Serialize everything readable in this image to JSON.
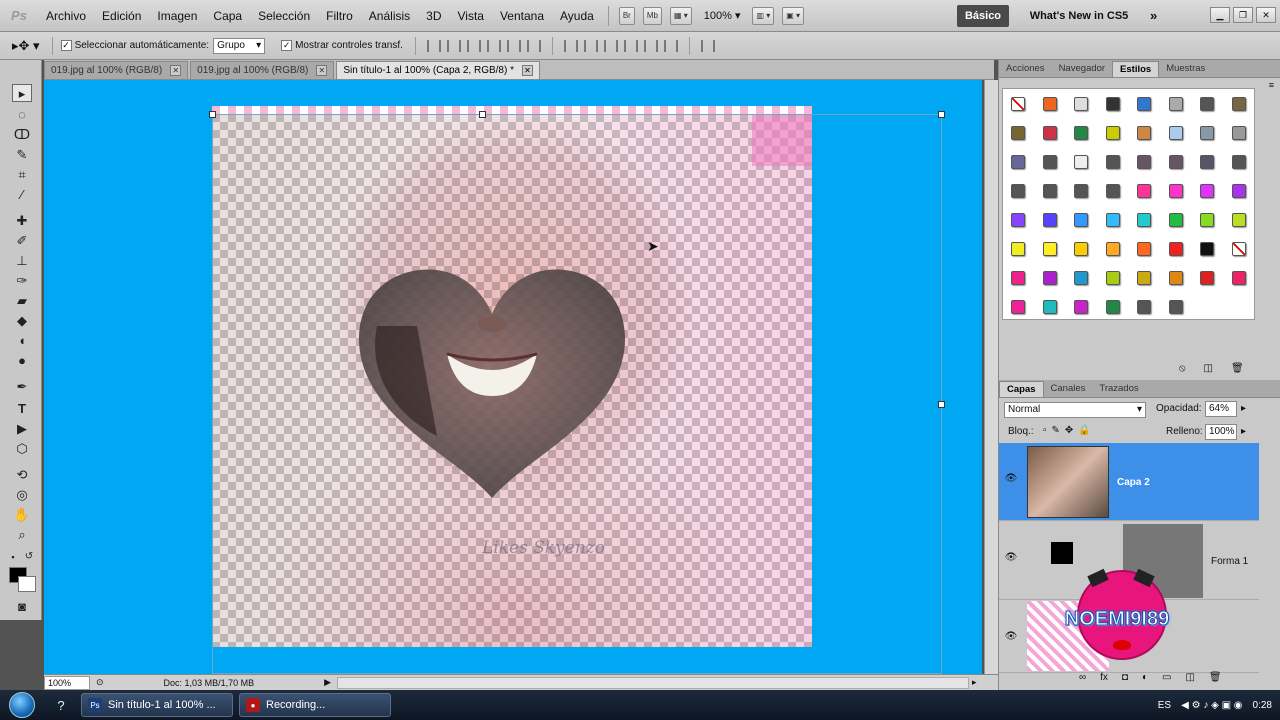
{
  "menubar": {
    "logo": "Ps",
    "items": [
      "Archivo",
      "Edición",
      "Imagen",
      "Capa",
      "Selección",
      "Filtro",
      "Análisis",
      "3D",
      "Vista",
      "Ventana",
      "Ayuda"
    ],
    "br_label": "Br",
    "mb_label": "Mb",
    "zoom": "100%",
    "workspace_active": "Básico",
    "workspace_new": "What's New in CS5"
  },
  "options": {
    "auto_select_label": "Seleccionar automáticamente:",
    "auto_select_value": "Grupo",
    "show_transform_label": "Mostrar controles transf."
  },
  "tabs": [
    {
      "label": "019.jpg al 100% (RGB/8)"
    },
    {
      "label": "019.jpg al 100% (RGB/8)"
    },
    {
      "label": "Sin título-1 al 100% (Capa 2, RGB/8) *"
    }
  ],
  "canvas": {
    "watermark": "Likes Skyenzo"
  },
  "status": {
    "zoom": "100%",
    "doc": "Doc: 1,03 MB/1,70 MB"
  },
  "panels": {
    "top_tabs": [
      "Acciones",
      "Navegador",
      "Estilos",
      "Muestras"
    ],
    "active_top_tab": "Estilos",
    "layer_tabs": [
      "Capas",
      "Canales",
      "Trazados"
    ],
    "blend_mode": "Normal",
    "opacity_label": "Opacidad:",
    "opacity_value": "64%",
    "lock_label": "Bloq.:",
    "fill_label": "Relleno:",
    "fill_value": "100%",
    "layers": [
      {
        "name": "Capa 2"
      },
      {
        "name": "Forma 1"
      }
    ],
    "logo_text": "NOEMI9I89"
  },
  "styles_swatches": [
    "#ffffff",
    "#ee6622",
    "#dddddd",
    "#333333",
    "#3377cc",
    "#aaaaaa",
    "#555555",
    "#776644",
    "#776633",
    "#cc3344",
    "#228844",
    "#cccc00",
    "#cc8844",
    "#aaccee",
    "#8899aa",
    "#999999",
    "#666699",
    "#555555",
    "#eeeeee",
    "#555555",
    "#665566",
    "#665566",
    "#555566",
    "#555555",
    "#555555",
    "#555555",
    "#555555",
    "#555555",
    "#ff3399",
    "#ff33cc",
    "#dd33ff",
    "#aa33ee",
    "#8844ff",
    "#5544ff",
    "#3399ff",
    "#33bbff",
    "#22cccc",
    "#22bb44",
    "#88dd22",
    "#bbdd22",
    "#eeee22",
    "#ffee22",
    "#ffcc00",
    "#ffaa22",
    "#ff6622",
    "#ee2222",
    "#111111",
    "#ffffff",
    "#ee2288",
    "#aa22cc",
    "#2299cc",
    "#aacc11",
    "#ccaa11",
    "#dd8811",
    "#dd2222",
    "#ee2266",
    "#ee2299",
    "#22bbbb",
    "#cc22cc",
    "#228844",
    "#555555",
    "#555555"
  ],
  "taskbar": {
    "task1": "Sin título-1 al 100% ...",
    "task2": "Recording...",
    "lang": "ES",
    "time": "0:28"
  }
}
